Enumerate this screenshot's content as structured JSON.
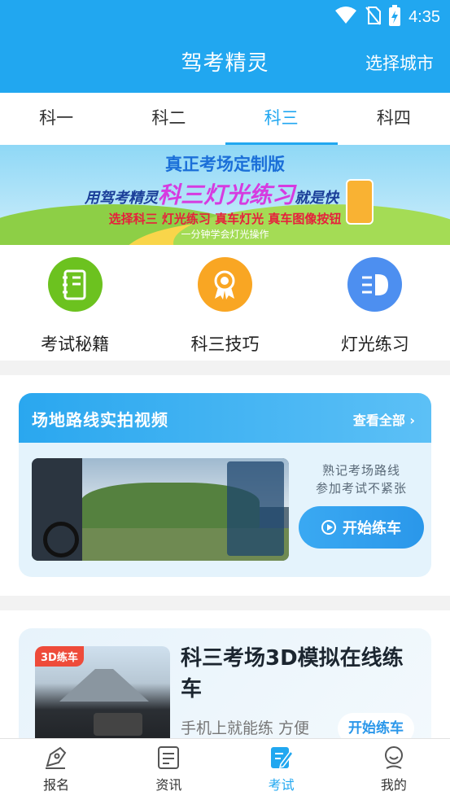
{
  "status_bar": {
    "time": "4:35",
    "icons": [
      "wifi-icon",
      "no-sim-icon",
      "battery-charging-icon"
    ]
  },
  "header": {
    "title": "驾考精灵",
    "city_button": "选择城市"
  },
  "subject_tabs": [
    {
      "label": "科一",
      "active": false
    },
    {
      "label": "科二",
      "active": false
    },
    {
      "label": "科三",
      "active": true
    },
    {
      "label": "科四",
      "active": false
    }
  ],
  "banner": {
    "line1": "真正考场定制版",
    "line2_prefix": "用驾考精灵",
    "line2_highlight": "科三灯光练习",
    "line2_suffix": "就是快",
    "line3": "选择科三 灯光练习 真车灯光 真车图像按钮",
    "line4": "一分钟学会灯光操作"
  },
  "quick_actions": [
    {
      "label": "考试秘籍",
      "icon": "notebook-icon",
      "color": "#6cc21f"
    },
    {
      "label": "科三技巧",
      "icon": "award-ribbon-icon",
      "color": "#f9a623"
    },
    {
      "label": "灯光练习",
      "icon": "headlight-icon",
      "color": "#4d8ff0"
    }
  ],
  "route_video_card": {
    "title": "场地路线实拍视频",
    "see_all": "查看全部",
    "tagline1": "熟记考场路线",
    "tagline2": "参加考试不紧张",
    "button": "开始练车"
  },
  "sim_card": {
    "tag": "3D练车",
    "title": "科三考场3D模拟在线练车",
    "subtitle": "手机上就能练 方便",
    "button": "开始练车"
  },
  "bottom_nav": [
    {
      "label": "报名",
      "icon": "pen-nib-icon",
      "active": false
    },
    {
      "label": "资讯",
      "icon": "news-icon",
      "active": false
    },
    {
      "label": "考试",
      "icon": "exam-edit-icon",
      "active": true
    },
    {
      "label": "我的",
      "icon": "profile-icon",
      "active": false
    }
  ],
  "colors": {
    "primary": "#21a7f0",
    "background": "#f2f2f2"
  }
}
